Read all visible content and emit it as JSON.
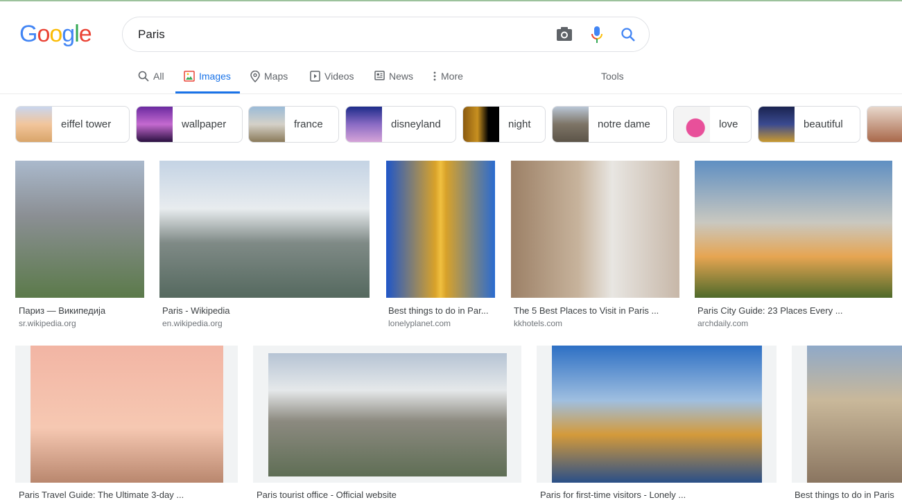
{
  "logo": "Google",
  "search": {
    "query": "Paris"
  },
  "tabs": [
    {
      "label": "All",
      "icon": "search-icon"
    },
    {
      "label": "Images",
      "icon": "image-icon",
      "active": true
    },
    {
      "label": "Maps",
      "icon": "map-pin-icon"
    },
    {
      "label": "Videos",
      "icon": "play-icon"
    },
    {
      "label": "News",
      "icon": "news-icon"
    },
    {
      "label": "More",
      "icon": "more-vert-icon"
    }
  ],
  "tools": "Tools",
  "chips": [
    "eiffel tower",
    "wallpaper",
    "france",
    "disneyland",
    "night",
    "notre dame",
    "love",
    "beautiful"
  ],
  "results": [
    {
      "title": "Париз — Википедија",
      "source": "sr.wikipedia.org"
    },
    {
      "title": "Paris - Wikipedia",
      "source": "en.wikipedia.org"
    },
    {
      "title": "Best things to do in Par...",
      "source": "lonelyplanet.com"
    },
    {
      "title": "The 5 Best Places to Visit in Paris ...",
      "source": "kkhotels.com"
    },
    {
      "title": "Paris City Guide: 23 Places Every ...",
      "source": "archdaily.com"
    },
    {
      "title": "Paris Travel Guide: The Ultimate 3-day ..."
    },
    {
      "title": "Paris tourist office - Official website"
    },
    {
      "title": "Paris for first-time visitors - Lonely ..."
    },
    {
      "title": "Best things to do in Paris"
    }
  ],
  "colors": {
    "accent": "#1a73e8",
    "text": "#202124",
    "muted": "#70757a"
  }
}
